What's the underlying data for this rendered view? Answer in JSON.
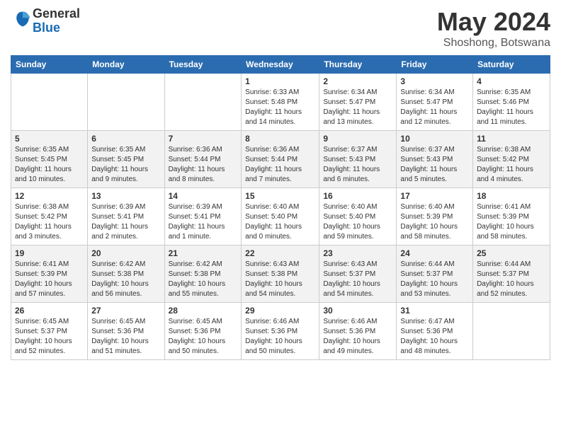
{
  "header": {
    "logo_general": "General",
    "logo_blue": "Blue",
    "month_title": "May 2024",
    "location": "Shoshong, Botswana"
  },
  "days_of_week": [
    "Sunday",
    "Monday",
    "Tuesday",
    "Wednesday",
    "Thursday",
    "Friday",
    "Saturday"
  ],
  "weeks": [
    [
      {
        "day": "",
        "info": ""
      },
      {
        "day": "",
        "info": ""
      },
      {
        "day": "",
        "info": ""
      },
      {
        "day": "1",
        "info": "Sunrise: 6:33 AM\nSunset: 5:48 PM\nDaylight: 11 hours and 14 minutes."
      },
      {
        "day": "2",
        "info": "Sunrise: 6:34 AM\nSunset: 5:47 PM\nDaylight: 11 hours and 13 minutes."
      },
      {
        "day": "3",
        "info": "Sunrise: 6:34 AM\nSunset: 5:47 PM\nDaylight: 11 hours and 12 minutes."
      },
      {
        "day": "4",
        "info": "Sunrise: 6:35 AM\nSunset: 5:46 PM\nDaylight: 11 hours and 11 minutes."
      }
    ],
    [
      {
        "day": "5",
        "info": "Sunrise: 6:35 AM\nSunset: 5:45 PM\nDaylight: 11 hours and 10 minutes."
      },
      {
        "day": "6",
        "info": "Sunrise: 6:35 AM\nSunset: 5:45 PM\nDaylight: 11 hours and 9 minutes."
      },
      {
        "day": "7",
        "info": "Sunrise: 6:36 AM\nSunset: 5:44 PM\nDaylight: 11 hours and 8 minutes."
      },
      {
        "day": "8",
        "info": "Sunrise: 6:36 AM\nSunset: 5:44 PM\nDaylight: 11 hours and 7 minutes."
      },
      {
        "day": "9",
        "info": "Sunrise: 6:37 AM\nSunset: 5:43 PM\nDaylight: 11 hours and 6 minutes."
      },
      {
        "day": "10",
        "info": "Sunrise: 6:37 AM\nSunset: 5:43 PM\nDaylight: 11 hours and 5 minutes."
      },
      {
        "day": "11",
        "info": "Sunrise: 6:38 AM\nSunset: 5:42 PM\nDaylight: 11 hours and 4 minutes."
      }
    ],
    [
      {
        "day": "12",
        "info": "Sunrise: 6:38 AM\nSunset: 5:42 PM\nDaylight: 11 hours and 3 minutes."
      },
      {
        "day": "13",
        "info": "Sunrise: 6:39 AM\nSunset: 5:41 PM\nDaylight: 11 hours and 2 minutes."
      },
      {
        "day": "14",
        "info": "Sunrise: 6:39 AM\nSunset: 5:41 PM\nDaylight: 11 hours and 1 minute."
      },
      {
        "day": "15",
        "info": "Sunrise: 6:40 AM\nSunset: 5:40 PM\nDaylight: 11 hours and 0 minutes."
      },
      {
        "day": "16",
        "info": "Sunrise: 6:40 AM\nSunset: 5:40 PM\nDaylight: 10 hours and 59 minutes."
      },
      {
        "day": "17",
        "info": "Sunrise: 6:40 AM\nSunset: 5:39 PM\nDaylight: 10 hours and 58 minutes."
      },
      {
        "day": "18",
        "info": "Sunrise: 6:41 AM\nSunset: 5:39 PM\nDaylight: 10 hours and 58 minutes."
      }
    ],
    [
      {
        "day": "19",
        "info": "Sunrise: 6:41 AM\nSunset: 5:39 PM\nDaylight: 10 hours and 57 minutes."
      },
      {
        "day": "20",
        "info": "Sunrise: 6:42 AM\nSunset: 5:38 PM\nDaylight: 10 hours and 56 minutes."
      },
      {
        "day": "21",
        "info": "Sunrise: 6:42 AM\nSunset: 5:38 PM\nDaylight: 10 hours and 55 minutes."
      },
      {
        "day": "22",
        "info": "Sunrise: 6:43 AM\nSunset: 5:38 PM\nDaylight: 10 hours and 54 minutes."
      },
      {
        "day": "23",
        "info": "Sunrise: 6:43 AM\nSunset: 5:37 PM\nDaylight: 10 hours and 54 minutes."
      },
      {
        "day": "24",
        "info": "Sunrise: 6:44 AM\nSunset: 5:37 PM\nDaylight: 10 hours and 53 minutes."
      },
      {
        "day": "25",
        "info": "Sunrise: 6:44 AM\nSunset: 5:37 PM\nDaylight: 10 hours and 52 minutes."
      }
    ],
    [
      {
        "day": "26",
        "info": "Sunrise: 6:45 AM\nSunset: 5:37 PM\nDaylight: 10 hours and 52 minutes."
      },
      {
        "day": "27",
        "info": "Sunrise: 6:45 AM\nSunset: 5:36 PM\nDaylight: 10 hours and 51 minutes."
      },
      {
        "day": "28",
        "info": "Sunrise: 6:45 AM\nSunset: 5:36 PM\nDaylight: 10 hours and 50 minutes."
      },
      {
        "day": "29",
        "info": "Sunrise: 6:46 AM\nSunset: 5:36 PM\nDaylight: 10 hours and 50 minutes."
      },
      {
        "day": "30",
        "info": "Sunrise: 6:46 AM\nSunset: 5:36 PM\nDaylight: 10 hours and 49 minutes."
      },
      {
        "day": "31",
        "info": "Sunrise: 6:47 AM\nSunset: 5:36 PM\nDaylight: 10 hours and 48 minutes."
      },
      {
        "day": "",
        "info": ""
      }
    ]
  ]
}
